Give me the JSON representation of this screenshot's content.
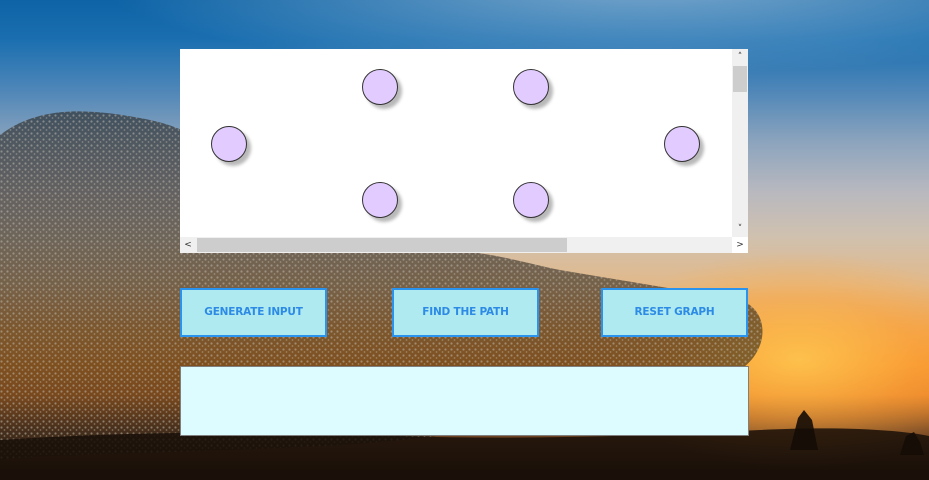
{
  "graph": {
    "nodes": [
      {
        "id": "node-1",
        "icon": "node-circle"
      },
      {
        "id": "node-2",
        "icon": "node-circle"
      },
      {
        "id": "node-3",
        "icon": "node-circle"
      },
      {
        "id": "node-4",
        "icon": "node-circle"
      },
      {
        "id": "node-5",
        "icon": "node-circle"
      },
      {
        "id": "node-6",
        "icon": "node-circle"
      }
    ],
    "node_color": "#e2ccff",
    "scroll_up_glyph": "˄",
    "scroll_down_glyph": "˅",
    "scroll_left_glyph": "<",
    "scroll_right_glyph": ">"
  },
  "buttons": {
    "generate_label": "GENERATE INPUT",
    "find_label": "FIND THE PATH",
    "reset_label": "RESET GRAPH"
  },
  "colors": {
    "button_fill": "#aeeaf0",
    "button_border": "#2a93ee",
    "button_text": "#2d8be6",
    "output_fill": "#ddfcff"
  },
  "output": {
    "text": ""
  }
}
